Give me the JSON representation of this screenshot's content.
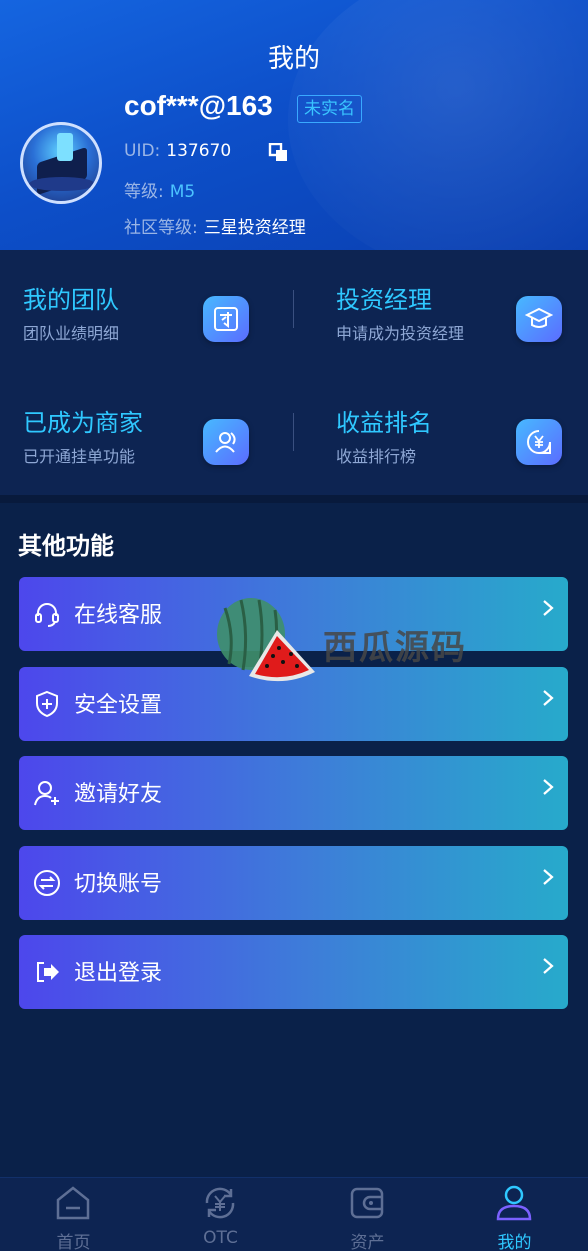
{
  "header": {
    "title": "我的",
    "username": "cof***@163",
    "verify_status": "未实名",
    "uid_label": "UID:",
    "uid_value": "137670",
    "level_label": "等级:",
    "level_value": "M5",
    "community_label": "社区等级:",
    "community_value": "三星投资经理"
  },
  "grid": [
    {
      "title": "我的团队",
      "subtitle": "团队业绩明细",
      "icon": "team-icon"
    },
    {
      "title": "投资经理",
      "subtitle": "申请成为投资经理",
      "icon": "graduation-cap-icon"
    },
    {
      "title": "已成为商家",
      "subtitle": "已开通挂单功能",
      "icon": "merchant-user-icon"
    },
    {
      "title": "收益排名",
      "subtitle": "收益排行榜",
      "icon": "yen-rank-icon"
    }
  ],
  "other": {
    "title": "其他功能",
    "items": [
      {
        "label": "在线客服",
        "icon": "headset-icon"
      },
      {
        "label": "安全设置",
        "icon": "shield-icon"
      },
      {
        "label": "邀请好友",
        "icon": "add-user-icon"
      },
      {
        "label": "切换账号",
        "icon": "switch-icon"
      },
      {
        "label": "退出登录",
        "icon": "logout-icon"
      }
    ]
  },
  "watermark": {
    "text": "西瓜源码"
  },
  "tabbar": {
    "tabs": [
      {
        "label": "首页",
        "icon": "home-icon",
        "active": false
      },
      {
        "label": "OTC",
        "icon": "otc-yen-icon",
        "active": false
      },
      {
        "label": "资产",
        "icon": "wallet-icon",
        "active": false
      },
      {
        "label": "我的",
        "icon": "profile-icon",
        "active": true
      }
    ]
  },
  "colors": {
    "accent": "#2fc8ff",
    "background": "#0a2149",
    "panel": "#0d2452",
    "menu_gradient_start": "#4d47ec",
    "menu_gradient_end": "#27aacb"
  }
}
